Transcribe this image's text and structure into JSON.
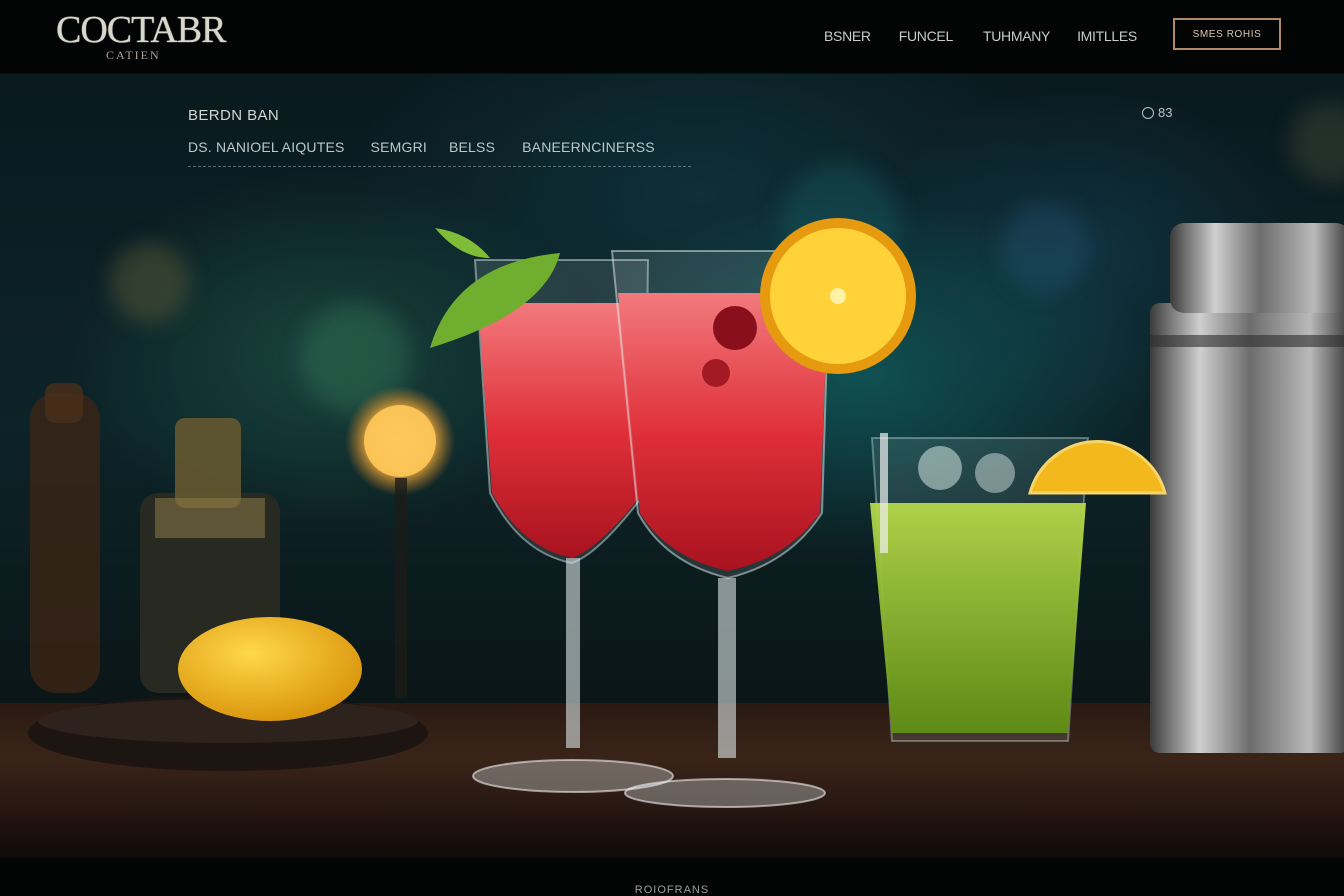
{
  "header": {
    "logo_main": "COCTABR",
    "logo_sub": "CATIEN",
    "nav": [
      "BSNER",
      "FUNCEL",
      "TUHMANY",
      "IMITLLES"
    ],
    "cta_label": "SMES ROHIS"
  },
  "hero": {
    "title": "BERDN BAN",
    "subnav": [
      "DS. NANIOEL AIQUTES",
      "SEMGRI",
      "BELSS",
      "BANEERNCINERSS"
    ],
    "counter": "83",
    "image_description_icons": [
      "cocktail-glass-icon",
      "lemon-icon",
      "shaker-icon"
    ]
  },
  "footer": {
    "text": "ROIOFRANS"
  },
  "colors": {
    "accent": "#b08a67",
    "background": "#040506",
    "cocktail_red": "#e23a3e",
    "cocktail_green": "#8fbf2a",
    "lemon": "#f2b81c"
  }
}
